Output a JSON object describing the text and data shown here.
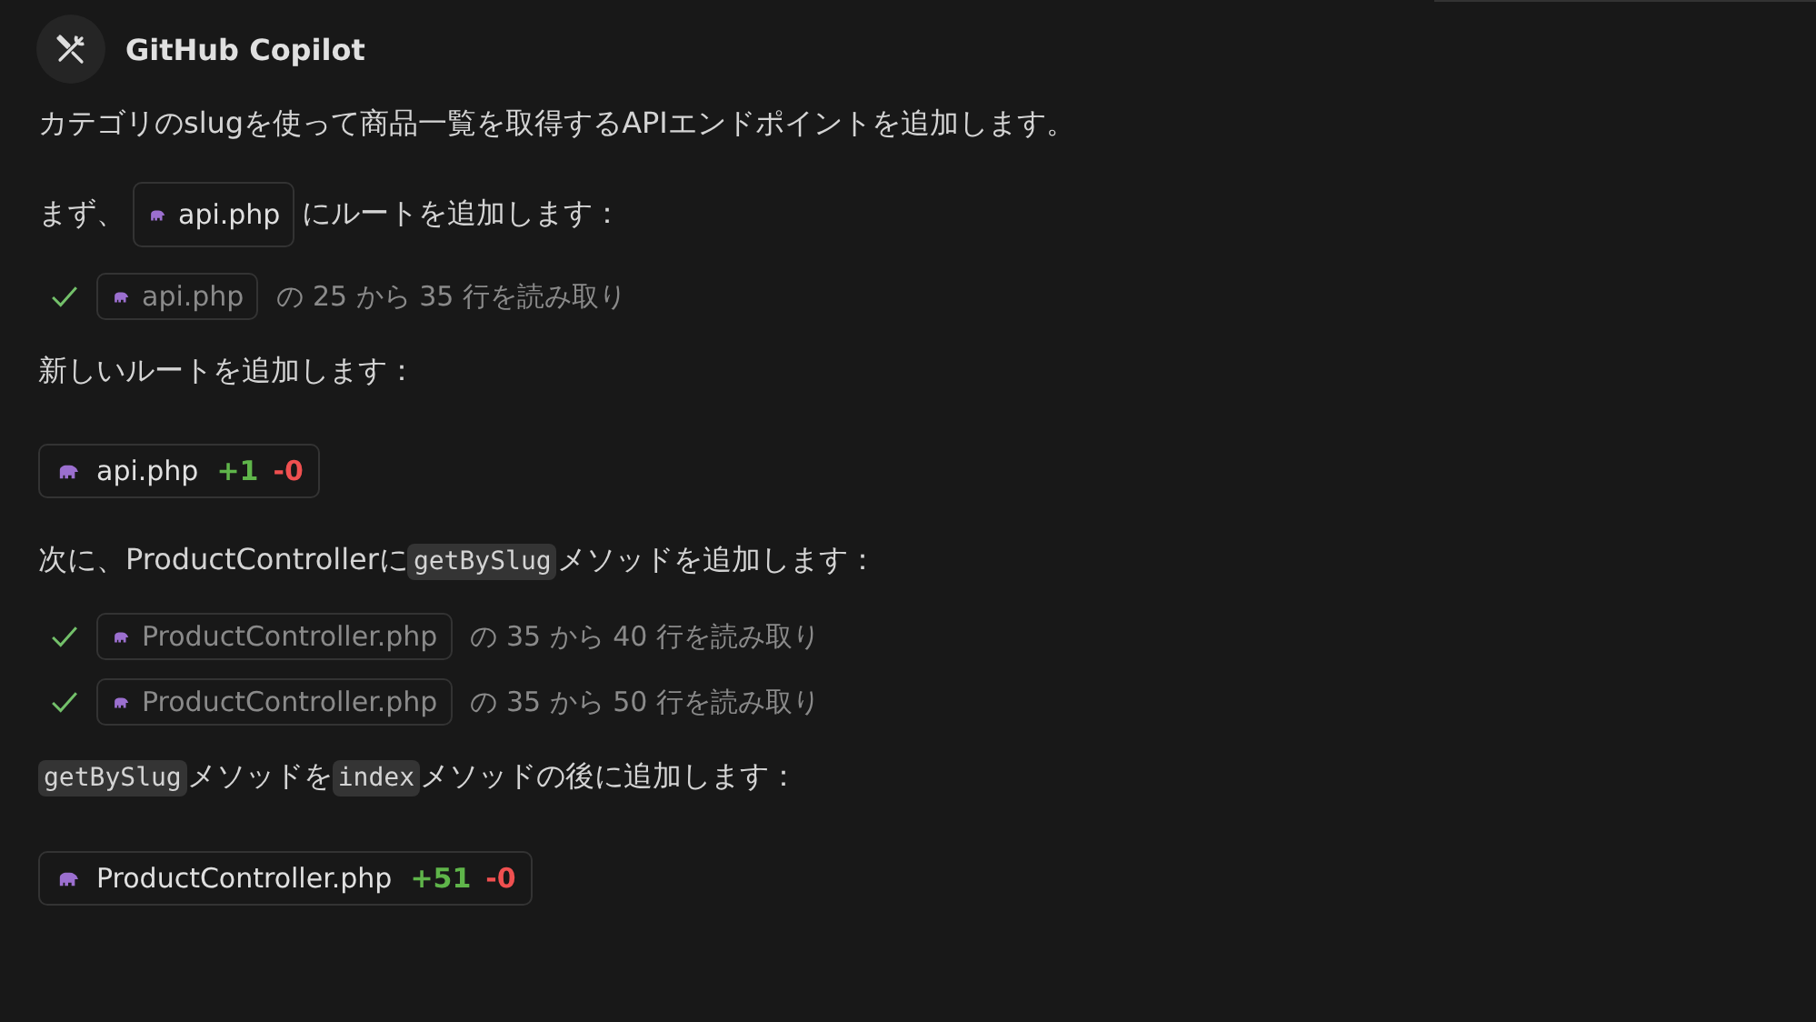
{
  "header": {
    "name": "GitHub Copilot"
  },
  "blocks": [
    {
      "kind": "paragraph",
      "parts": [
        {
          "kind": "text",
          "text": "カテゴリのslugを使って商品一覧を取得するAPIエンドポイントを追加します。"
        }
      ]
    },
    {
      "kind": "paragraph",
      "parts": [
        {
          "kind": "text",
          "text": "まず、"
        },
        {
          "kind": "file",
          "text": "api.php"
        },
        {
          "kind": "text",
          "text": "にルートを追加します："
        }
      ]
    },
    {
      "kind": "read",
      "file": "api.php",
      "text": "の 25 から 35 行を読み取り",
      "done": true
    },
    {
      "kind": "paragraph",
      "parts": [
        {
          "kind": "text",
          "text": "新しいルートを追加します："
        }
      ]
    },
    {
      "kind": "edit",
      "file": "api.php",
      "added": "+1",
      "removed": "-0"
    },
    {
      "kind": "paragraph",
      "parts": [
        {
          "kind": "text",
          "text": "次に、ProductControllerに"
        },
        {
          "kind": "code",
          "text": "getBySlug"
        },
        {
          "kind": "text",
          "text": "メソッドを追加します："
        }
      ]
    },
    {
      "kind": "read",
      "file": "ProductController.php",
      "text": "の 35 から 40 行を読み取り",
      "done": true
    },
    {
      "kind": "read",
      "file": "ProductController.php",
      "text": "の 35 から 50 行を読み取り",
      "done": true
    },
    {
      "kind": "paragraph",
      "parts": [
        {
          "kind": "code",
          "text": "getBySlug"
        },
        {
          "kind": "text",
          "text": "メソッドを"
        },
        {
          "kind": "code",
          "text": "index"
        },
        {
          "kind": "text",
          "text": "メソッドの後に追加します："
        }
      ]
    },
    {
      "kind": "edit",
      "file": "ProductController.php",
      "added": "+51",
      "removed": "-0"
    }
  ]
}
